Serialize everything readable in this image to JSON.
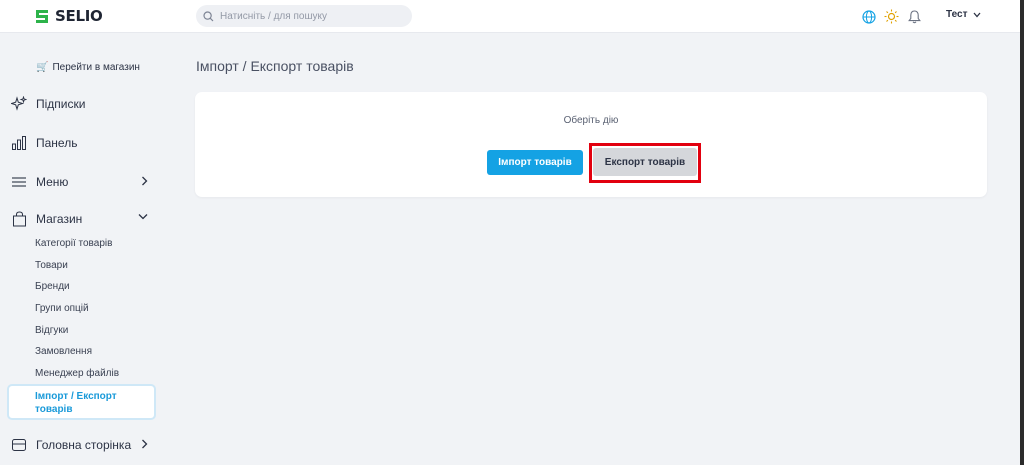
{
  "header": {
    "brand": "SELIO",
    "search_placeholder": "Натисніть / для пошуку",
    "user_name": "Тест",
    "icons": [
      "globe-icon",
      "sun-icon",
      "bell-icon",
      "chevron-down-icon"
    ],
    "accent_color": "#14a2e4",
    "logo_color": "#2db34a"
  },
  "sidebar": {
    "go_store": "Перейти в магазин",
    "items": [
      {
        "label": "Підписки",
        "icon": "sparkle-icon"
      },
      {
        "label": "Панель",
        "icon": "bar-chart-icon"
      },
      {
        "label": "Меню",
        "icon": "menu-lines-icon"
      },
      {
        "label": "Магазин",
        "icon": "shopping-bag-icon"
      },
      {
        "label": "Головна сторінка",
        "icon": "layout-icon"
      }
    ],
    "shop_sub": [
      "Категорії товарів",
      "Товари",
      "Бренди",
      "Групи опцій",
      "Відгуки",
      "Замовлення",
      "Менеджер файлів"
    ],
    "active_line1": "Імпорт / Експорт",
    "active_line2": "товарів"
  },
  "main": {
    "title": "Імпорт / Експорт товарів",
    "caption": "Оберіть дію",
    "import_label": "Імпорт товарів",
    "export_label": "Експорт товарів",
    "highlight_color": "#e2000f"
  }
}
